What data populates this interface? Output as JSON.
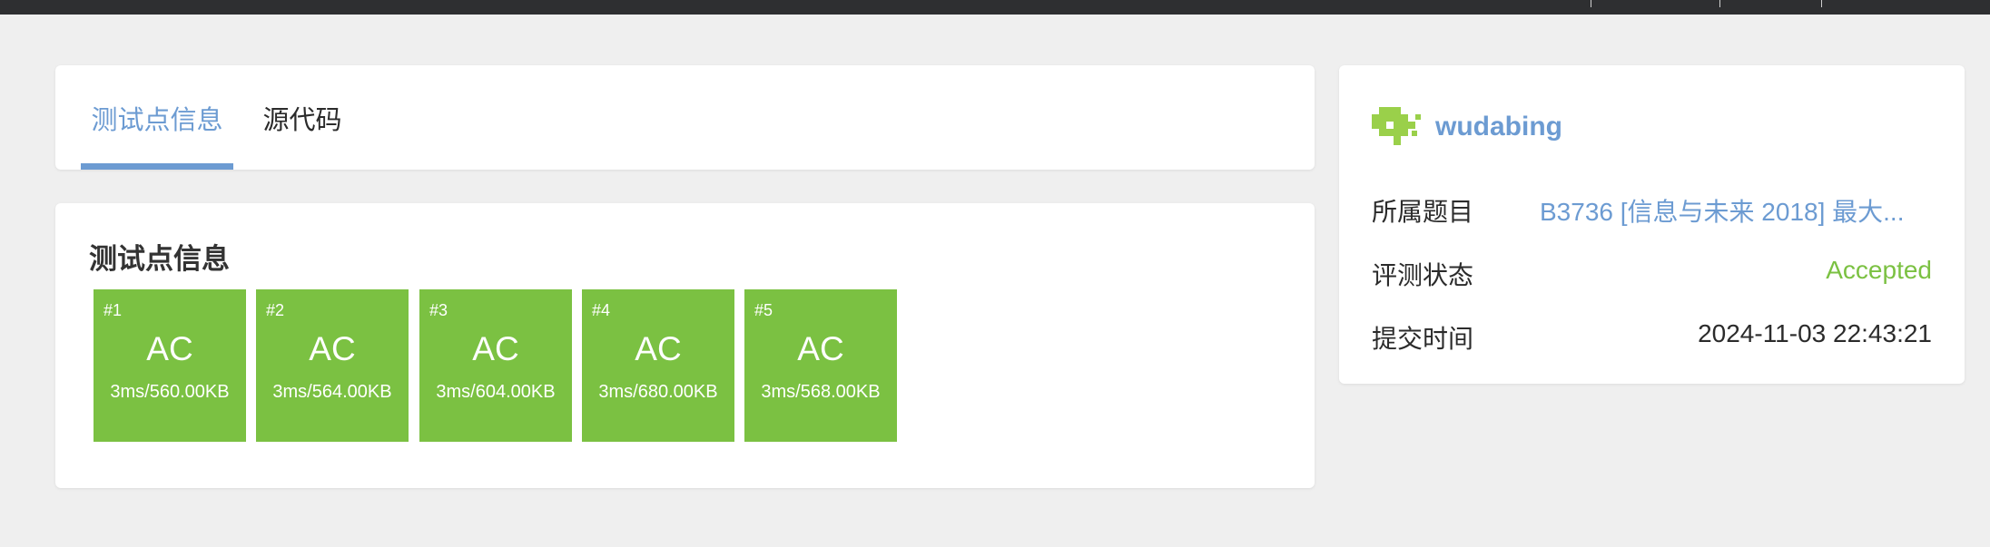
{
  "tabs": [
    {
      "label": "测试点信息",
      "active": true
    },
    {
      "label": "源代码",
      "active": false
    }
  ],
  "test_points": {
    "title": "测试点信息",
    "tile_color": "#7bc142",
    "items": [
      {
        "index": "#1",
        "result": "AC",
        "stats": "3ms/560.00KB"
      },
      {
        "index": "#2",
        "result": "AC",
        "stats": "3ms/564.00KB"
      },
      {
        "index": "#3",
        "result": "AC",
        "stats": "3ms/604.00KB"
      },
      {
        "index": "#4",
        "result": "AC",
        "stats": "3ms/680.00KB"
      },
      {
        "index": "#5",
        "result": "AC",
        "stats": "3ms/568.00KB"
      }
    ]
  },
  "sidebar": {
    "username": "wudabing",
    "problem_label": "所属题目",
    "problem_value": "B3736 [信息与未来 2018] 最大...",
    "status_label": "评测状态",
    "status_value": "Accepted",
    "status_color": "#7bc142",
    "time_label": "提交时间",
    "time_value": "2024-11-03 22:43:21"
  },
  "colors": {
    "accent": "#6c9bd2",
    "accepted": "#7bc142"
  }
}
